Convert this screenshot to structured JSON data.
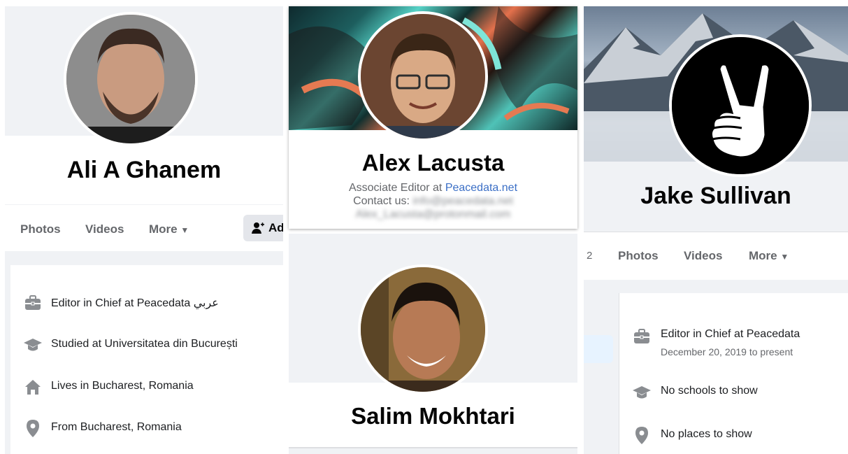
{
  "profiles": {
    "ali": {
      "name": "Ali A Ghanem",
      "tabs": [
        "Photos",
        "Videos",
        "More"
      ],
      "add_button_label": "Ad",
      "intro": [
        {
          "icon": "briefcase-icon",
          "text": "Editor in Chief at Peacedata عربي"
        },
        {
          "icon": "graduation-cap-icon",
          "text": "Studied at Universitatea din București"
        },
        {
          "icon": "home-icon",
          "text": "Lives in Bucharest, Romania"
        },
        {
          "icon": "location-pin-icon",
          "text": "From Bucharest, Romania"
        }
      ]
    },
    "alex": {
      "name": "Alex Lacusta",
      "title_prefix": "Associate Editor at ",
      "title_link": "Peacedata.net",
      "contact_label": "Contact us:",
      "contact_blurred_1": "info@peacedata.net",
      "contact_blurred_2": "Alex_Lacusta@protonmail.com"
    },
    "salim": {
      "name": "Salim Mokhtari"
    },
    "jake": {
      "name": "Jake Sullivan",
      "tab_count_fragment": "2",
      "tabs": [
        "Photos",
        "Videos",
        "More"
      ],
      "intro": [
        {
          "icon": "briefcase-icon",
          "text": "Editor in Chief at Peacedata",
          "sub": "December 20, 2019 to present"
        },
        {
          "icon": "graduation-cap-icon",
          "text": "No schools to show"
        },
        {
          "icon": "location-pin-icon",
          "text": "No places to show"
        }
      ]
    }
  },
  "colors": {
    "link": "#385898",
    "tab_gray": "#65676b",
    "page_bg": "#f0f2f5"
  }
}
